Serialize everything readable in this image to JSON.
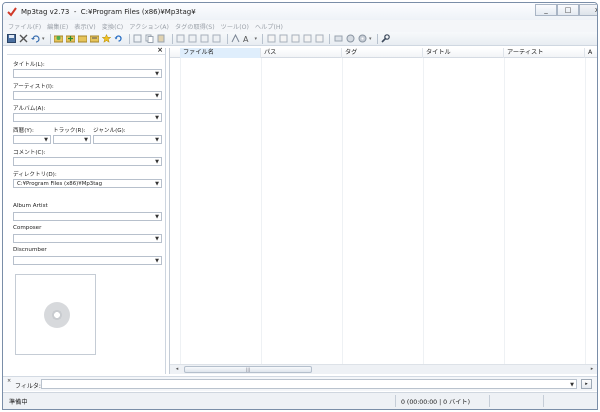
{
  "window": {
    "title": "Mp3tag v2.73  -  C:¥Program Files (x86)¥Mp3tag¥",
    "controls": {
      "minimize": "_",
      "maximize": "□",
      "close": "x"
    }
  },
  "menubar": {
    "items": [
      {
        "label": "ファイル(F)"
      },
      {
        "label": "編集(E)"
      },
      {
        "label": "表示(V)"
      },
      {
        "label": "変換(C)"
      },
      {
        "label": "アクション(A)"
      },
      {
        "label": "タグの取得(S)"
      },
      {
        "label": "ツール(O)"
      },
      {
        "label": "ヘルプ(H)"
      }
    ]
  },
  "left_panel": {
    "close_label": "×",
    "fields": {
      "title_label": "タイトル(L):",
      "artist_label": "アーティスト(I):",
      "album_label": "アルバム(A):",
      "year_label": "西暦(Y):",
      "track_label": "トラック(R):",
      "genre_label": "ジャンル(G):",
      "comment_label": "コメント(C):",
      "directory_label": "ディレクトリ(D):",
      "directory_value": "C:¥Program Files (x86)¥Mp3tag",
      "album_artist_label": "Album Artist",
      "composer_label": "Composer",
      "discnumber_label": "Discnumber"
    }
  },
  "file_list": {
    "columns": [
      {
        "label": "ファイル名"
      },
      {
        "label": "パス"
      },
      {
        "label": "タグ"
      },
      {
        "label": "タイトル"
      },
      {
        "label": "アーティスト"
      },
      {
        "label": "A"
      }
    ],
    "rows": [],
    "scroll_thumb": "|||"
  },
  "filter": {
    "label": "フィルタ:",
    "value": "",
    "go_label": "▸"
  },
  "status": {
    "left": "準備中",
    "right": "0 (00:00:00 | 0 バイト)"
  }
}
